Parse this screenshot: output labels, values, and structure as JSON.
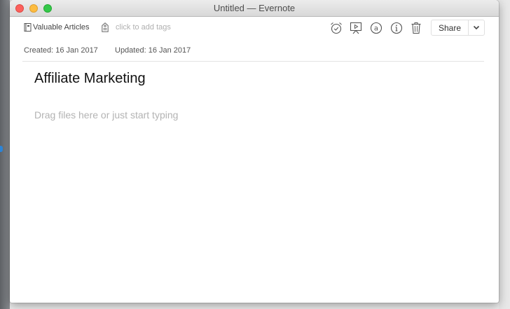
{
  "window": {
    "title": "Untitled — Evernote"
  },
  "toolbar": {
    "notebook_name": "Valuable Articles",
    "tags_placeholder": "click to add tags",
    "share_label": "Share",
    "icons": [
      "reminder-icon",
      "present-icon",
      "at-mention-icon",
      "info-icon",
      "trash-icon",
      "chevron-down-icon"
    ]
  },
  "meta": {
    "created": "Created: 16 Jan 2017",
    "updated": "Updated: 16 Jan 2017"
  },
  "note": {
    "title": "Affiliate Marketing",
    "body_placeholder": "Drag files here or just start typing"
  },
  "colors": {
    "close": "#fc605c",
    "minimize": "#fdbc40",
    "maximize": "#34c84a",
    "icon_stroke": "#555555",
    "placeholder": "#b3b3b3"
  }
}
